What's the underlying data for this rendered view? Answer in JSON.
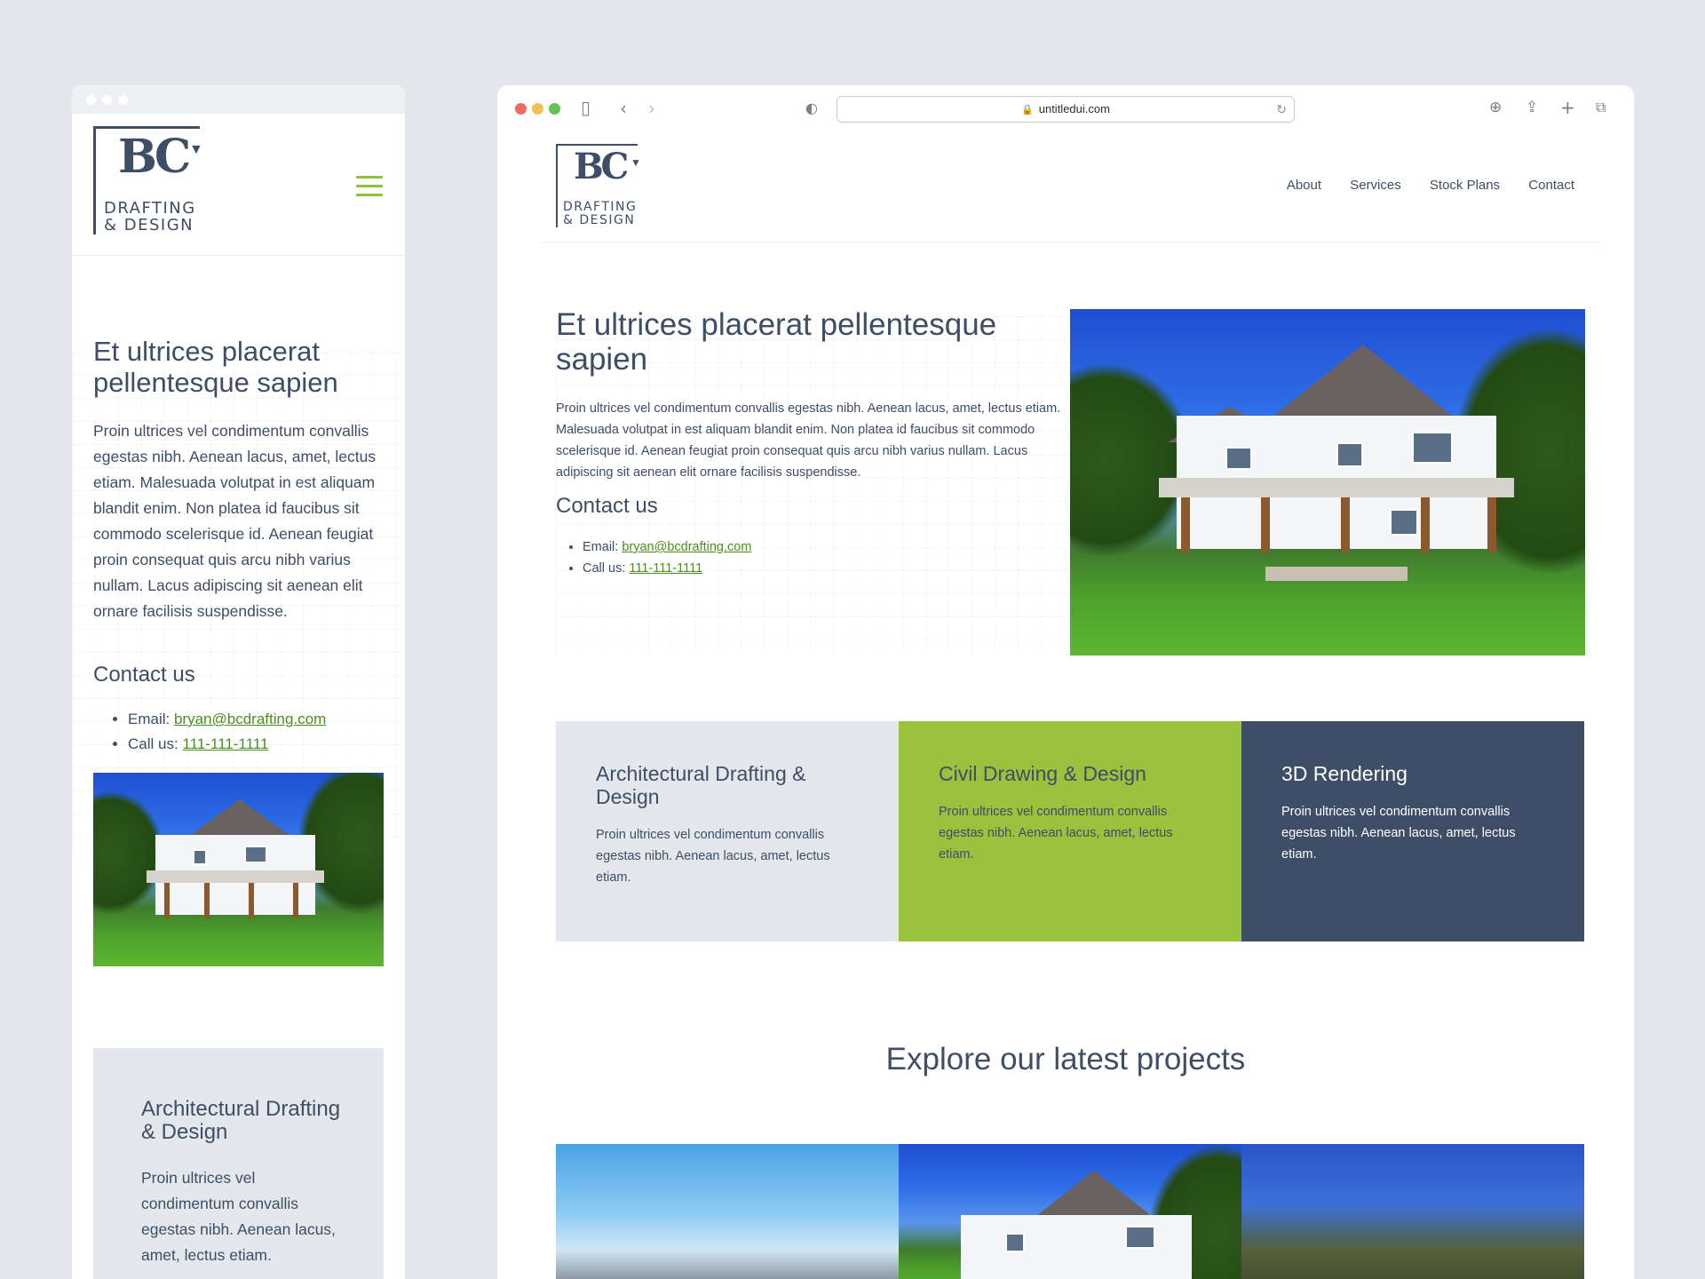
{
  "brand": {
    "logo_mark": "BC",
    "logo_line1": "DRAFTING",
    "logo_line2": "& DESIGN",
    "accent_color": "#8cc23c",
    "dark_color": "#3d4e66",
    "light_color": "#e4e7ec"
  },
  "browser": {
    "url": "untitledui.com"
  },
  "nav": {
    "items": [
      "About",
      "Services",
      "Stock Plans",
      "Contact"
    ]
  },
  "hero": {
    "title": "Et ultrices placerat pellentesque sapien",
    "body": "Proin ultrices vel condimentum convallis egestas nibh. Aenean lacus, amet, lectus etiam. Malesuada volutpat in est aliquam blandit enim. Non platea id faucibus sit commodo scelerisque id. Aenean feugiat proin consequat quis arcu nibh varius nullam. Lacus adipiscing sit aenean elit ornare facilisis suspendisse.",
    "contact_heading": "Contact us",
    "email_label": "Email:",
    "email": "bryan@bcdrafting.com",
    "phone_label": "Call us:",
    "phone": "111-111-1111"
  },
  "services": [
    {
      "title": "Architectural Drafting & Design",
      "body": "Proin ultrices vel condimentum convallis egestas nibh. Aenean lacus, amet, lectus etiam."
    },
    {
      "title": "Civil Drawing & Design",
      "body": "Proin ultrices vel condimentum convallis egestas nibh. Aenean lacus, amet, lectus etiam."
    },
    {
      "title": "3D Rendering",
      "body": "Proin ultrices vel condimentum convallis egestas nibh. Aenean lacus, amet, lectus etiam."
    }
  ],
  "projects": {
    "title": "Explore our latest projects"
  },
  "icons": [
    "sidebar-icon",
    "back-icon",
    "forward-icon",
    "shield-icon",
    "lock-icon",
    "reload-icon",
    "download-icon",
    "share-icon",
    "new-tab-icon",
    "tabs-icon",
    "hamburger-menu-icon"
  ]
}
